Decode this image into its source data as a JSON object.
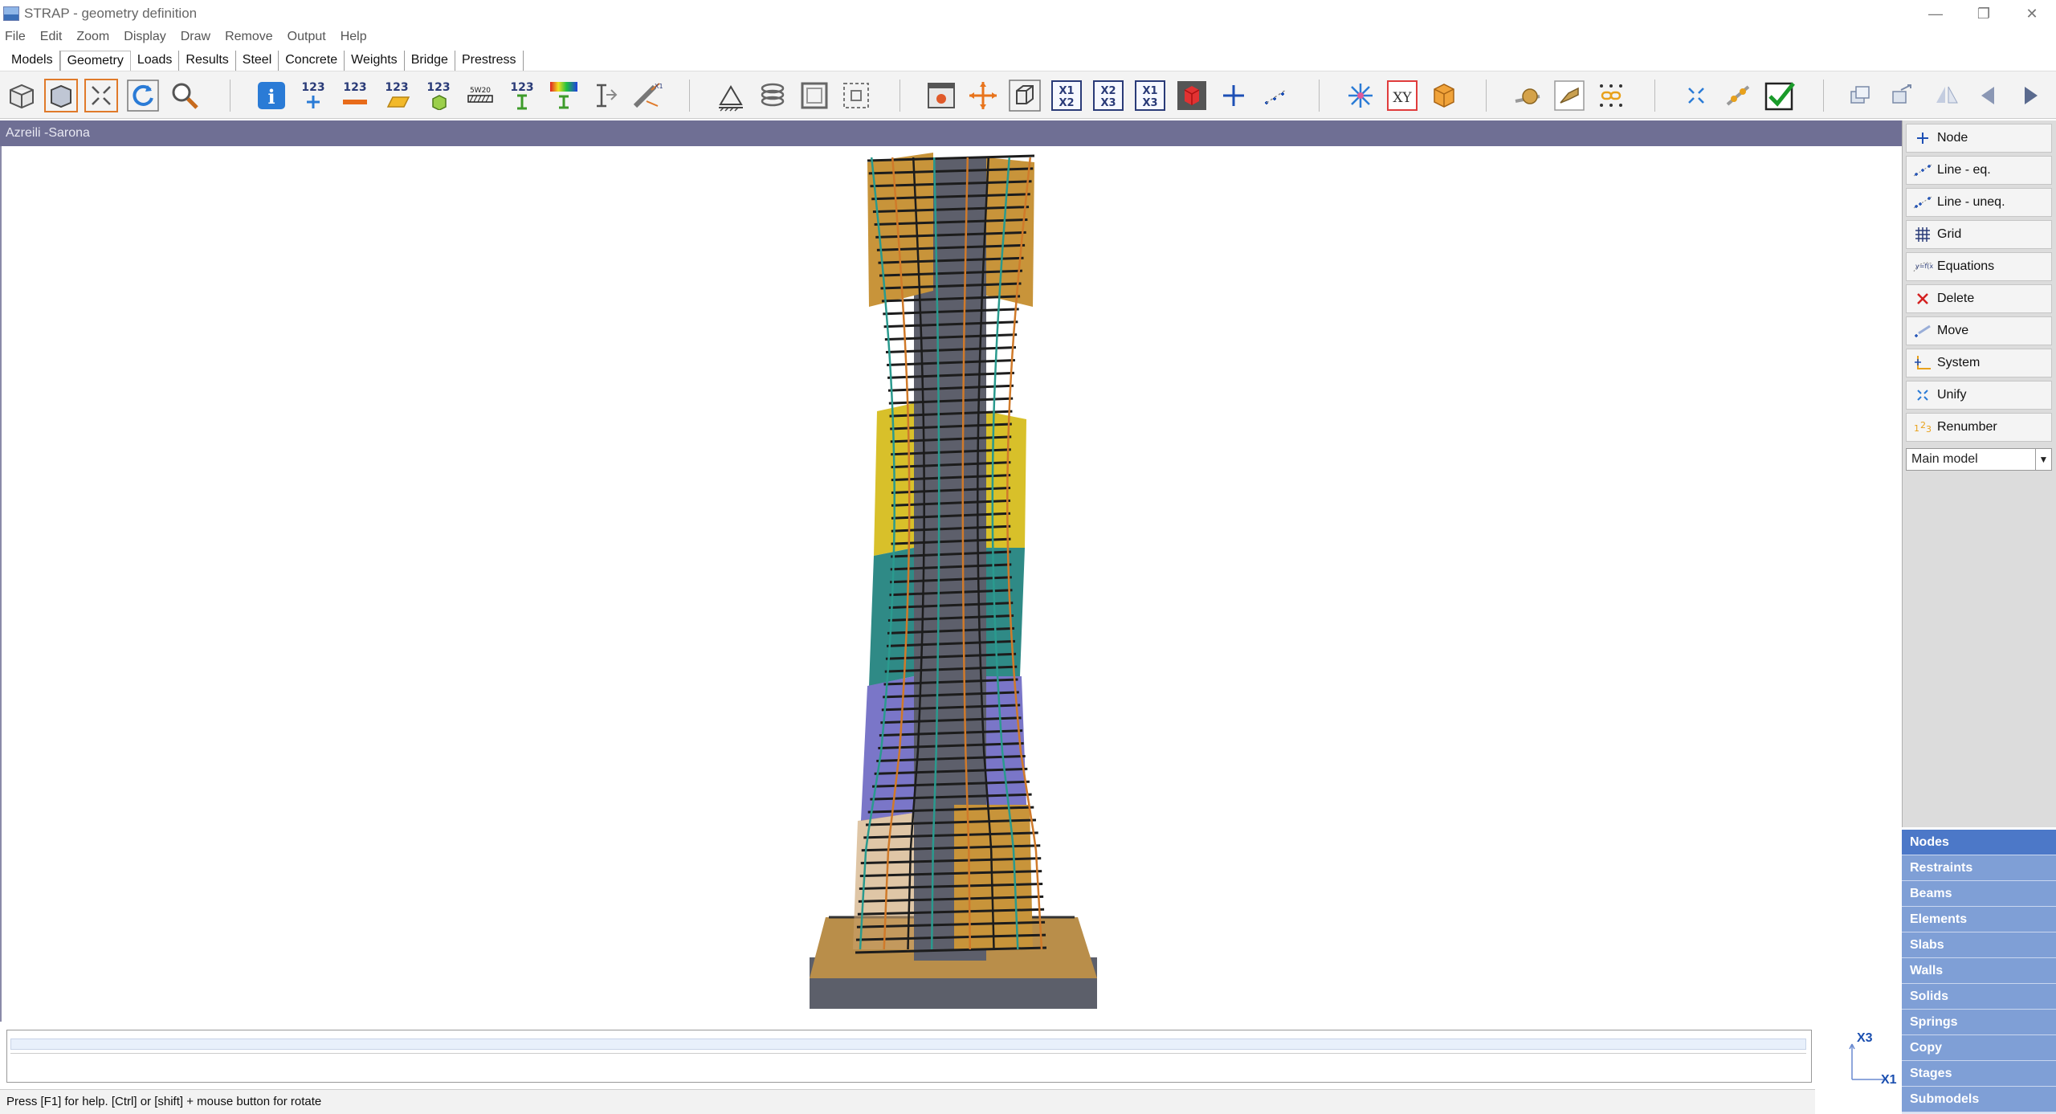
{
  "window": {
    "title": "STRAP - geometry definition",
    "minimize_glyph": "—",
    "restore_glyph": "❐",
    "close_glyph": "✕"
  },
  "menu": [
    "File",
    "Edit",
    "Zoom",
    "Display",
    "Draw",
    "Remove",
    "Output",
    "Help"
  ],
  "tabs": [
    {
      "label": "Models",
      "active": false
    },
    {
      "label": "Geometry",
      "active": true
    },
    {
      "label": "Loads",
      "active": false
    },
    {
      "label": "Results",
      "active": false
    },
    {
      "label": "Steel",
      "active": false
    },
    {
      "label": "Concrete",
      "active": false
    },
    {
      "label": "Weights",
      "active": false
    },
    {
      "label": "Bridge",
      "active": false
    },
    {
      "label": "Prestress",
      "active": false
    }
  ],
  "toolbar": {
    "number_label": "123",
    "x1x2_label": [
      "X1",
      "X2"
    ],
    "x2x3_label": [
      "X2",
      "X3"
    ],
    "x1x3_label": [
      "X1",
      "X3"
    ],
    "xy_label": "XY"
  },
  "model_title": "Azreili -Sarona",
  "right_panel": {
    "buttons": [
      {
        "label": "Node",
        "icon": "plus-icon"
      },
      {
        "label": "Line - eq.",
        "icon": "line-equal-icon"
      },
      {
        "label": "Line - uneq.",
        "icon": "line-unequal-icon"
      },
      {
        "label": "Grid",
        "icon": "grid-icon"
      },
      {
        "label": "Equations",
        "icon": "equations-icon"
      },
      {
        "label": "Delete",
        "icon": "delete-icon"
      },
      {
        "label": "Move",
        "icon": "move-icon"
      },
      {
        "label": "System",
        "icon": "system-icon"
      },
      {
        "label": "Unify",
        "icon": "unify-icon"
      },
      {
        "label": "Renumber",
        "icon": "renumber-icon"
      }
    ],
    "model_select": "Main model"
  },
  "categories": [
    {
      "label": "Nodes",
      "active": true
    },
    {
      "label": "Restraints",
      "active": false
    },
    {
      "label": "Beams",
      "active": false
    },
    {
      "label": "Elements",
      "active": false
    },
    {
      "label": "Slabs",
      "active": false
    },
    {
      "label": "Walls",
      "active": false
    },
    {
      "label": "Solids",
      "active": false
    },
    {
      "label": "Springs",
      "active": false
    },
    {
      "label": "Copy",
      "active": false
    },
    {
      "label": "Stages",
      "active": false
    },
    {
      "label": "Submodels",
      "active": false
    }
  ],
  "axis": {
    "vertical": "X3",
    "horizontal": "X1"
  },
  "status": "Press [F1] for help. [Ctrl] or [shift] + mouse button for rotate",
  "colors": {
    "accent": "#4c78c8",
    "category": "#7f9fd6",
    "model_strip": "#6f6f94",
    "slab_orange": "#c8943a",
    "slab_yellow": "#d8c02a",
    "slab_teal": "#2f8a86",
    "slab_purple": "#7a76c8",
    "core_gray": "#5d5f6b"
  }
}
